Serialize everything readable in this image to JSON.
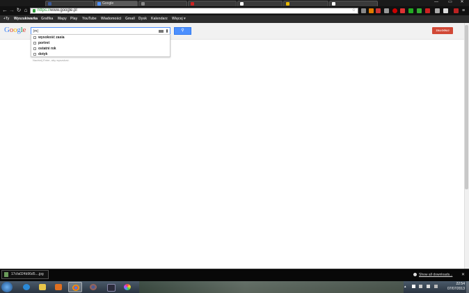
{
  "browser": {
    "tabs": [
      {
        "label": "",
        "favicon_color": "#3b5998"
      },
      {
        "label": "Google",
        "favicon_color": "#4d90fe",
        "active": true
      },
      {
        "label": "",
        "favicon_color": "#888888"
      },
      {
        "label": "",
        "favicon_color": "#cc2222"
      },
      {
        "label": "",
        "favicon_color": "#ffffff"
      },
      {
        "label": "",
        "favicon_color": "#e8b800"
      },
      {
        "label": "",
        "favicon_color": "#ffffff"
      }
    ],
    "url_prefix": "https://",
    "url_host": "www.google.pl",
    "nav": {
      "back": "←",
      "forward": "→",
      "reload": "↻",
      "home": "⌂"
    },
    "window_controls": {
      "minimize": "—",
      "close": "✕"
    }
  },
  "google_bar": {
    "items": [
      "+Ty",
      "Wyszukiwarka",
      "Grafika",
      "Mapy",
      "Play",
      "YouTube",
      "Wiadomości",
      "Gmail",
      "Dysk",
      "Kalendarz",
      "Więcej ▾"
    ]
  },
  "page": {
    "logo": "Google",
    "search_value": "|m|",
    "sign_in": "ZALOGUJ",
    "suggestions": [
      {
        "text": "wysokość zasia"
      },
      {
        "text": "portret"
      },
      {
        "text": "ostatni rok"
      },
      {
        "text": "dotyk"
      }
    ],
    "hint": "Naciśnij Enter, aby wyszukać."
  },
  "downloads": {
    "file_name": "17cfa024b96d5....jpg",
    "show_all": "Show all downloads...",
    "close": "✕"
  },
  "taskbar": {
    "time": "22:54",
    "date": "07/07/2013"
  },
  "colors": {
    "brand_blue": "#4285f4",
    "signin_red": "#d14836",
    "search_blue": "#4d90fe"
  }
}
